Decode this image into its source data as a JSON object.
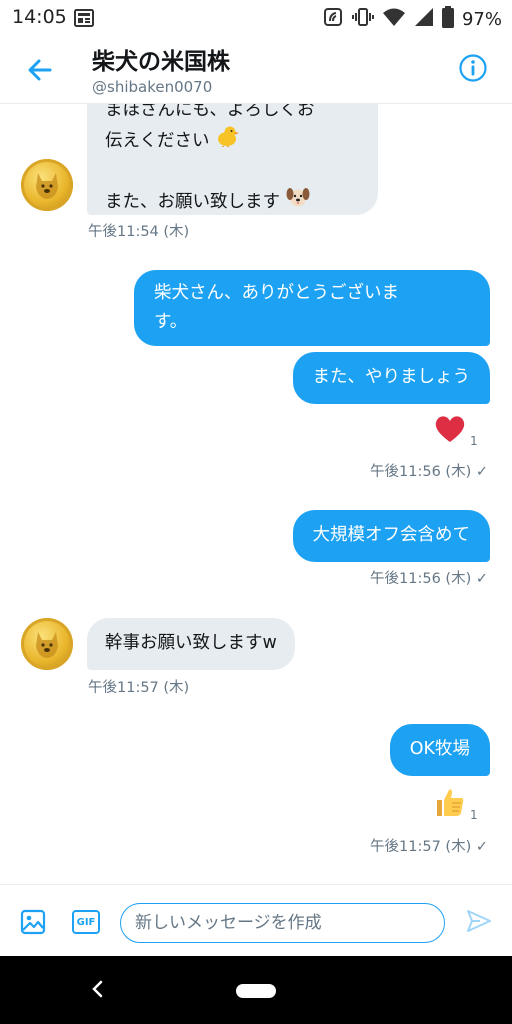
{
  "status_bar": {
    "time": "14:05",
    "battery": "97%"
  },
  "header": {
    "title": "柴犬の米国株",
    "handle": "@shibaken0070",
    "back_icon": "back-arrow-icon",
    "info_icon": "info-icon",
    "accent": "#1da1f2"
  },
  "messages": [
    {
      "direction": "in",
      "lines": [
        "まほさんにも、よろしくお",
        "伝えください"
      ],
      "emoji_1": "chick-emoji",
      "line3": "また、お願い致します",
      "emoji_2": "dog-face-emoji",
      "timestamp": "午後11:54 (木)"
    },
    {
      "direction": "out",
      "lines": [
        "柴犬さん、ありがとうございま",
        "す。"
      ]
    },
    {
      "direction": "out",
      "text": "また、やりましょう",
      "reaction": {
        "icon": "red-heart-emoji",
        "count": "1"
      },
      "timestamp": "午後11:56 (木) ✓"
    },
    {
      "direction": "out",
      "text": "大規模オフ会含めて",
      "timestamp": "午後11:56 (木) ✓"
    },
    {
      "direction": "in",
      "text": "幹事お願い致しますw",
      "timestamp": "午後11:57 (木)"
    },
    {
      "direction": "out",
      "text": "OK牧場",
      "reaction": {
        "icon": "thumbs-up-emoji",
        "count": "1"
      },
      "timestamp": "午後11:57 (木) ✓"
    }
  ],
  "composer": {
    "placeholder": "新しいメッセージを作成",
    "gif_label": "GIF",
    "image_icon": "image-icon",
    "send_icon": "send-icon"
  },
  "colors": {
    "outgoing_bubble": "#1da1f2",
    "incoming_bubble": "#e6ecf0",
    "secondary_text": "#657786"
  }
}
